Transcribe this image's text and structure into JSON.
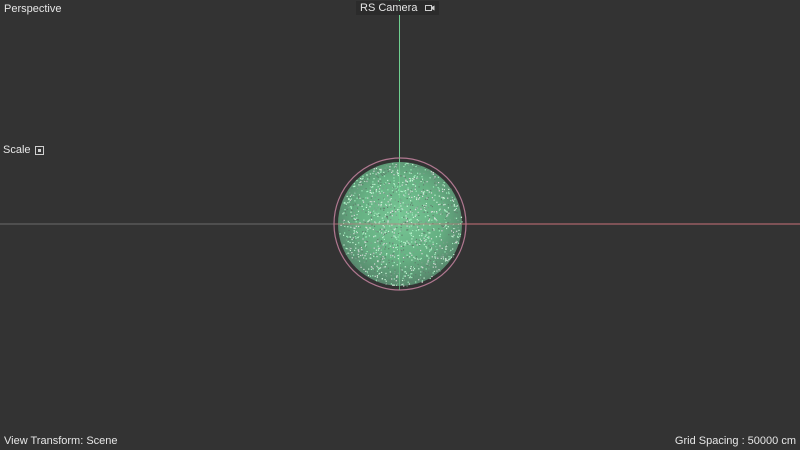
{
  "viewport": {
    "view_name": "Perspective",
    "camera_name": "RS Camera",
    "scale_label": "Scale",
    "view_transform": "View Transform: Scene",
    "grid_spacing": "Grid Spacing : 50000 cm"
  },
  "icons": {
    "camera_icon": "camera-icon",
    "scale_icon": "scale-handle-icon"
  },
  "colors": {
    "background": "#333333",
    "y_axis": "#6fcf8f",
    "x_axis": "#c9707a",
    "particles": "#8fe3b0",
    "sphere_outline": "#b07890"
  }
}
